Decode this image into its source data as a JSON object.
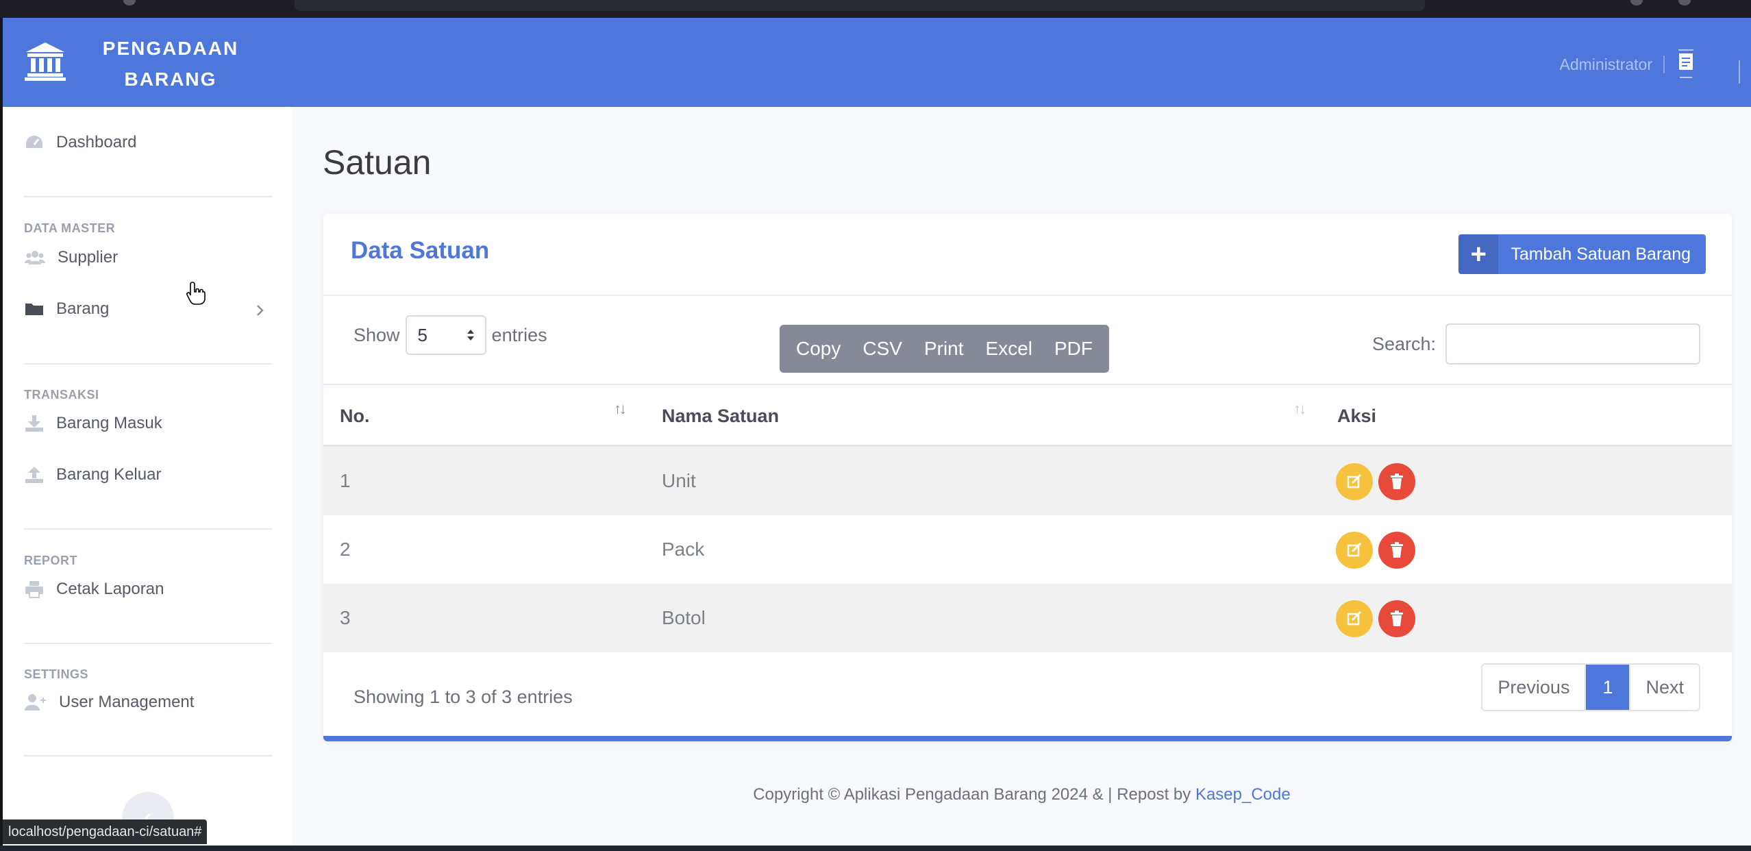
{
  "brand": {
    "line1": "PENGADAAN",
    "line2": "BARANG"
  },
  "topbar": {
    "user_name": "Administrator"
  },
  "sidebar": {
    "dashboard": "Dashboard",
    "sections": [
      {
        "heading": "DATA MASTER",
        "items": [
          "Supplier",
          "Barang"
        ]
      },
      {
        "heading": "TRANSAKSI",
        "items": [
          "Barang Masuk",
          "Barang Keluar"
        ]
      },
      {
        "heading": "REPORT",
        "items": [
          "Cetak Laporan"
        ]
      },
      {
        "heading": "SETTINGS",
        "items": [
          "User Management"
        ]
      }
    ]
  },
  "page": {
    "title": "Satuan"
  },
  "card": {
    "title": "Data Satuan",
    "add_button": "Tambah Satuan Barang",
    "show_label": "Show",
    "entries_value": "5",
    "entries_label": "entries",
    "export_buttons": [
      "Copy",
      "CSV",
      "Print",
      "Excel",
      "PDF"
    ],
    "search_label": "Search:",
    "search_value": "",
    "columns": [
      "No.",
      "Nama Satuan",
      "Aksi"
    ],
    "rows": [
      {
        "no": "1",
        "nama": "Unit"
      },
      {
        "no": "2",
        "nama": "Pack"
      },
      {
        "no": "3",
        "nama": "Botol"
      }
    ],
    "info": "Showing 1 to 3 of 3 entries",
    "pager": {
      "previous": "Previous",
      "current": "1",
      "next": "Next"
    }
  },
  "footer": {
    "text": "Copyright © Aplikasi Pengadaan Barang 2024 & | Repost by ",
    "link": "Kasep_Code"
  },
  "status_bar": {
    "url": "localhost/pengadaan-ci/satuan#"
  },
  "colors": {
    "primary": "#4e77dc",
    "edit": "#f6c23e",
    "delete": "#e74a3b"
  },
  "icons": {
    "brand": "bank-icon",
    "dashboard": "tachometer-icon",
    "supplier": "users-icon",
    "barang": "folder-icon",
    "barang_masuk": "download-icon",
    "barang_keluar": "upload-icon",
    "cetak_laporan": "print-icon",
    "user_management": "user-plus-icon"
  }
}
